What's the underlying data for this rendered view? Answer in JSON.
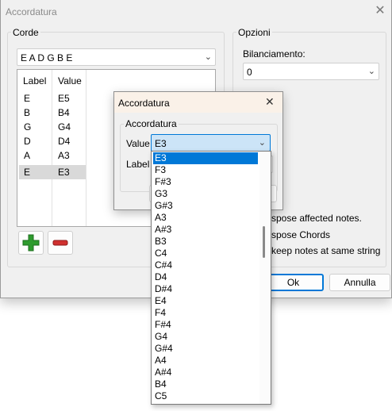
{
  "main": {
    "title": "Accordatura",
    "close_glyph": "✕",
    "corde": {
      "title": "Corde",
      "tuning_value": "E A D G B E",
      "columns": [
        "Label",
        "Value"
      ],
      "rows": [
        {
          "label": "E",
          "value": "E5"
        },
        {
          "label": "B",
          "value": "B4"
        },
        {
          "label": "G",
          "value": "G4"
        },
        {
          "label": "D",
          "value": "D4"
        },
        {
          "label": "A",
          "value": "A3"
        },
        {
          "label": "E",
          "value": "E3"
        }
      ],
      "add_icon": "plus-icon",
      "remove_icon": "minus-icon"
    },
    "opzioni": {
      "title": "Opzioni",
      "balance_label": "Bilanciamento:",
      "balance_value": "0",
      "checks": [
        "spose affected notes.",
        "spose Chords",
        "keep notes at same string"
      ]
    },
    "ok_label": "Ok",
    "cancel_label": "Annulla"
  },
  "dialog": {
    "title": "Accordatura",
    "close_glyph": "✕",
    "group_title": "Accordatura",
    "value_label": "Value",
    "value_selected": "E3",
    "label_label": "Label"
  },
  "dropdown": {
    "options": [
      "E3",
      "F3",
      "F#3",
      "G3",
      "G#3",
      "A3",
      "A#3",
      "B3",
      "C4",
      "C#4",
      "D4",
      "D#4",
      "E4",
      "F4",
      "F#4",
      "G4",
      "G#4",
      "A4",
      "A#4",
      "B4",
      "C5"
    ]
  },
  "colors": {
    "selection": "#0078d7",
    "add": "#2e9b2e",
    "remove": "#d0302f"
  }
}
